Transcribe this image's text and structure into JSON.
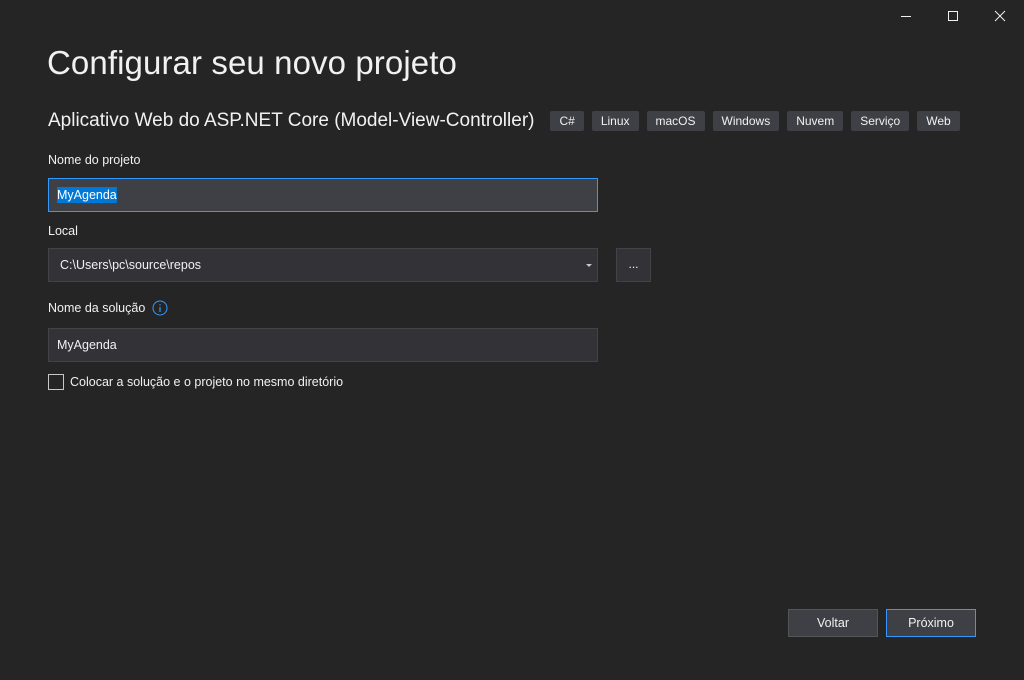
{
  "window": {
    "minimize_icon": "minimize-icon",
    "maximize_icon": "maximize-icon",
    "close_icon": "close-icon"
  },
  "header": {
    "title": "Configurar seu novo projeto",
    "template_name": "Aplicativo Web do ASP.NET Core (Model-View-Controller)",
    "tags": [
      "C#",
      "Linux",
      "macOS",
      "Windows",
      "Nuvem",
      "Serviço",
      "Web"
    ]
  },
  "form": {
    "project_name": {
      "label": "Nome do projeto",
      "value": "MyAgenda"
    },
    "location": {
      "label": "Local",
      "value": "C:\\Users\\pc\\source\\repos",
      "browse_label": "..."
    },
    "solution_name": {
      "label": "Nome da solução",
      "value": "MyAgenda",
      "info_icon": "info-icon"
    },
    "same_directory": {
      "label": "Colocar a solução e o projeto no mesmo diretório",
      "checked": false
    }
  },
  "footer": {
    "back_label": "Voltar",
    "next_label": "Próximo"
  },
  "colors": {
    "background": "#252526",
    "input_background": "#333337",
    "accent": "#3399ff",
    "selection": "#0078d7"
  }
}
